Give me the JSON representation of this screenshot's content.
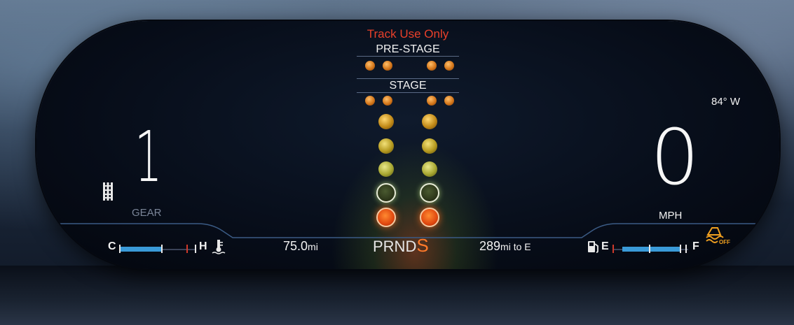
{
  "banner": {
    "track_notice": "Track Use Only",
    "prestage_label": "PRE-STAGE",
    "stage_label": "STAGE"
  },
  "gear": {
    "value": "1",
    "label": "GEAR"
  },
  "speed": {
    "value": "0",
    "unit": "MPH"
  },
  "outside_temp": "84° W",
  "trip": {
    "value": "75.0",
    "unit": "mi"
  },
  "transmission": {
    "letters": "PRND",
    "selected": "S"
  },
  "range": {
    "value": "289",
    "unit": "mi to E"
  },
  "coolant_gauge": {
    "low_label": "C",
    "high_label": "H",
    "level": 0.55
  },
  "fuel_gauge": {
    "empty_label": "E",
    "full_label": "F",
    "level": 0.85
  },
  "traction": {
    "state_label": "OFF"
  },
  "colors": {
    "accent_orange": "#ff7a2a",
    "warning_red": "#e8402a",
    "gauge_blue": "#3a9ad8"
  }
}
